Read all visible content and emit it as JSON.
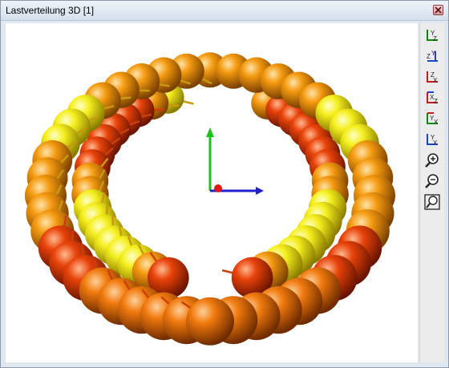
{
  "window": {
    "title": "Lastverteilung 3D [1]"
  },
  "toolbar": {
    "buttons": [
      {
        "name": "view-yz-icon",
        "label": "view YZ"
      },
      {
        "name": "view-zy-icon",
        "label": "view ZY"
      },
      {
        "name": "view-zx-icon",
        "label": "view ZX"
      },
      {
        "name": "view-xz-icon",
        "label": "view XZ"
      },
      {
        "name": "view-yx-icon",
        "label": "view YX"
      },
      {
        "name": "view-xy-icon",
        "label": "view XY"
      },
      {
        "name": "zoom-in-icon",
        "label": "zoom in"
      },
      {
        "name": "zoom-out-icon",
        "label": "zoom out"
      },
      {
        "name": "zoom-fit-icon",
        "label": "zoom to fit"
      }
    ]
  },
  "colors": {
    "sphere_yellow": "#f5ef1e",
    "sphere_orange": "#f49a10",
    "sphere_red": "#e8430a",
    "axis_x": "#1f1fd0",
    "axis_y": "#19c419",
    "axis_z": "#e01616"
  }
}
